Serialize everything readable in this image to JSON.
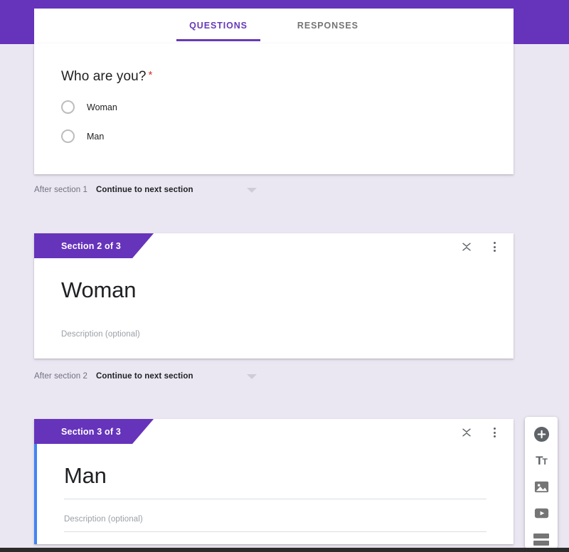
{
  "header": {
    "band_color": "#6633bb",
    "tabs": [
      {
        "label": "QUESTIONS",
        "active": true
      },
      {
        "label": "RESPONSES",
        "active": false
      }
    ]
  },
  "question_card": {
    "title": "Who are you?",
    "required_marker": "*",
    "options": [
      {
        "label": "Woman",
        "selected": false
      },
      {
        "label": "Man",
        "selected": false
      }
    ]
  },
  "navigation_rows": [
    {
      "label": "After section 1",
      "value": "Continue to next section"
    },
    {
      "label": "After section 2",
      "value": "Continue to next section"
    }
  ],
  "sections": [
    {
      "tab_label": "Section 2 of 3",
      "title": "Woman",
      "description_placeholder": "Description (optional)",
      "selected": false,
      "collapse_icon": "collapse-icon",
      "menu_icon": "more-vert-icon"
    },
    {
      "tab_label": "Section 3 of 3",
      "title": "Man",
      "description_placeholder": "Description (optional)",
      "selected": true,
      "selected_accent": "#4285f4",
      "collapse_icon": "collapse-icon",
      "menu_icon": "more-vert-icon"
    }
  ],
  "toolbar": {
    "items": [
      {
        "name": "add-question-icon",
        "label": "Add question"
      },
      {
        "name": "add-title-icon",
        "label": "Add title and description",
        "glyph": "T",
        "glyph_small": "T"
      },
      {
        "name": "add-image-icon",
        "label": "Add image"
      },
      {
        "name": "add-video-icon",
        "label": "Add video"
      },
      {
        "name": "add-section-icon",
        "label": "Add section"
      }
    ]
  },
  "theme": {
    "purple": "#6633bb",
    "accent_blue": "#4285f4",
    "page_background": "#ebe7f2",
    "required_red": "#d93025"
  }
}
